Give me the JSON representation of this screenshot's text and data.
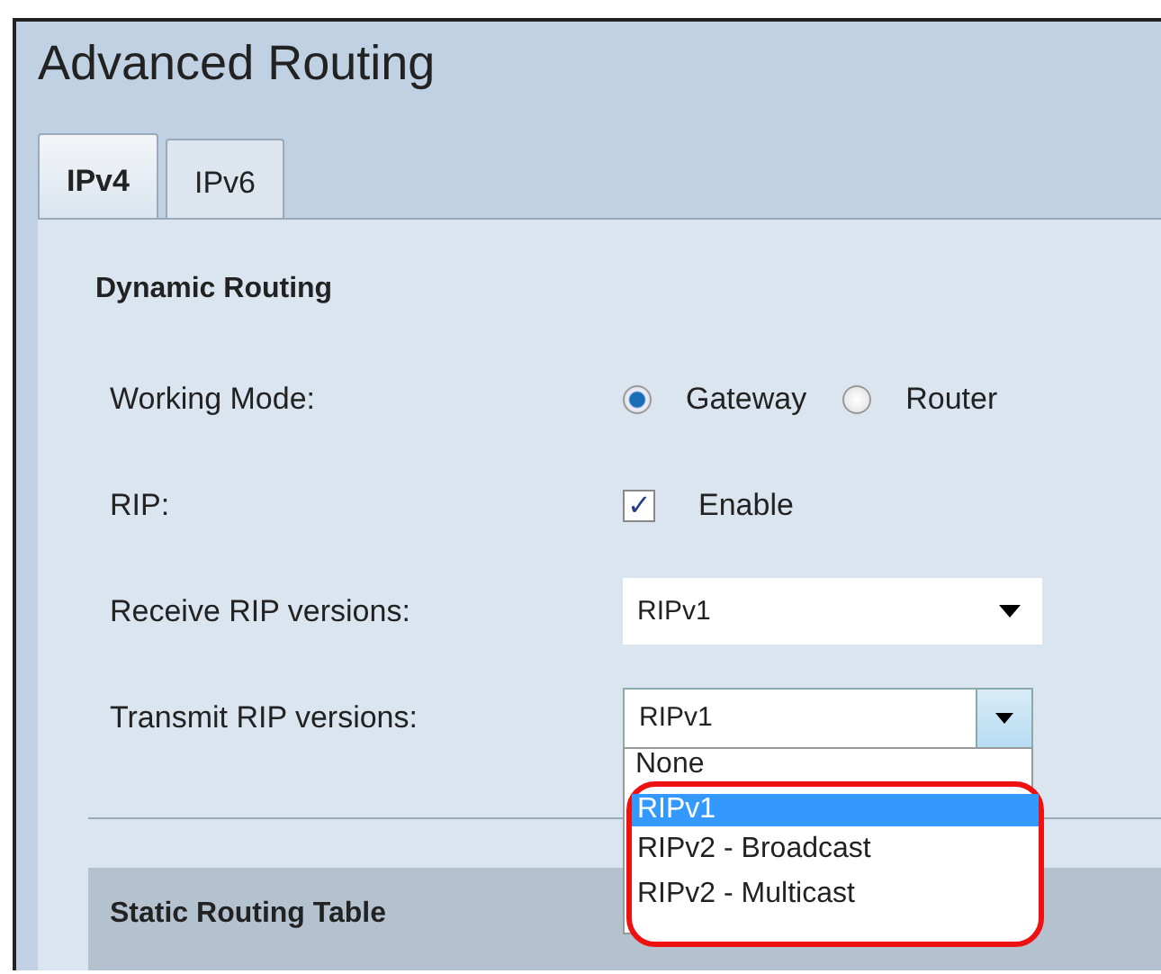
{
  "page": {
    "title": "Advanced Routing"
  },
  "tabs": [
    {
      "label": "IPv4",
      "selected": true
    },
    {
      "label": "IPv6",
      "selected": false
    }
  ],
  "section": {
    "title": "Dynamic Routing"
  },
  "working_mode": {
    "label": "Working Mode:",
    "options": [
      {
        "label": "Gateway",
        "selected": true
      },
      {
        "label": "Router",
        "selected": false
      }
    ]
  },
  "rip": {
    "label": "RIP:",
    "option": "Enable",
    "checked": true,
    "tick": "✓"
  },
  "receive": {
    "label": "Receive RIP versions:",
    "value": "RIPv1"
  },
  "transmit": {
    "label": "Transmit RIP versions:",
    "value": "RIPv1",
    "expanded": true,
    "options": [
      {
        "label": "None",
        "selected": false
      },
      {
        "label": "RIPv1",
        "selected": true
      },
      {
        "label": "RIPv2 - Broadcast",
        "selected": false
      },
      {
        "label": "RIPv2 - Multicast",
        "selected": false
      }
    ]
  },
  "static_table": {
    "title": "Static Routing Table"
  }
}
